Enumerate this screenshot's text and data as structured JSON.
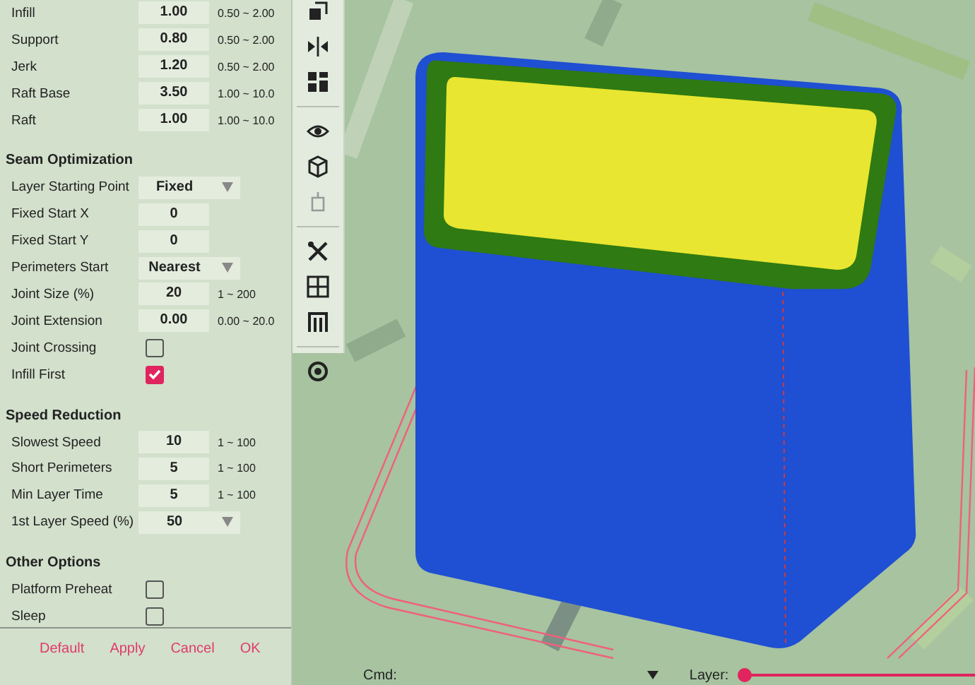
{
  "sections": [
    {
      "rows": [
        {
          "kind": "number",
          "label": "Infill",
          "value": "1.00",
          "range": "0.50 ~ 2.00"
        },
        {
          "kind": "number",
          "label": "Support",
          "value": "0.80",
          "range": "0.50 ~ 2.00"
        },
        {
          "kind": "number",
          "label": "Jerk",
          "value": "1.20",
          "range": "0.50 ~ 2.00"
        },
        {
          "kind": "number",
          "label": "Raft Base",
          "value": "3.50",
          "range": "1.00 ~ 10.0"
        },
        {
          "kind": "number",
          "label": "Raft",
          "value": "1.00",
          "range": "1.00 ~ 10.0"
        }
      ]
    },
    {
      "heading": "Seam Optimization",
      "rows": [
        {
          "kind": "select",
          "label": "Layer Starting Point",
          "value": "Fixed"
        },
        {
          "kind": "number",
          "label": "Fixed Start X",
          "value": "0"
        },
        {
          "kind": "number",
          "label": "Fixed Start Y",
          "value": "0"
        },
        {
          "kind": "select",
          "label": "Perimeters Start",
          "value": "Nearest"
        },
        {
          "kind": "number",
          "label": "Joint Size (%)",
          "value": "20",
          "range": "1 ~ 200"
        },
        {
          "kind": "number",
          "label": "Joint Extension",
          "value": "0.00",
          "range": "0.00 ~ 20.0"
        },
        {
          "kind": "checkbox",
          "label": "Joint Crossing",
          "checked": false
        },
        {
          "kind": "checkbox",
          "label": "Infill First",
          "checked": true
        }
      ]
    },
    {
      "heading": "Speed Reduction",
      "rows": [
        {
          "kind": "number",
          "label": "Slowest Speed",
          "value": "10",
          "range": "1 ~ 100"
        },
        {
          "kind": "number",
          "label": "Short Perimeters",
          "value": "5",
          "range": "1 ~ 100"
        },
        {
          "kind": "number",
          "label": "Min Layer Time",
          "value": "5",
          "range": "1 ~ 100"
        },
        {
          "kind": "select",
          "label": "1st Layer Speed (%)",
          "value": "50"
        }
      ]
    },
    {
      "heading": "Other Options",
      "rows": [
        {
          "kind": "checkbox",
          "label": "Platform Preheat",
          "checked": false
        },
        {
          "kind": "checkbox",
          "label": "Sleep",
          "checked": false
        }
      ]
    }
  ],
  "buttons": [
    "Default",
    "Apply",
    "Cancel",
    "OK"
  ],
  "cmd": {
    "label": "Cmd:"
  },
  "layer": {
    "label": "Layer:",
    "level": 0
  }
}
